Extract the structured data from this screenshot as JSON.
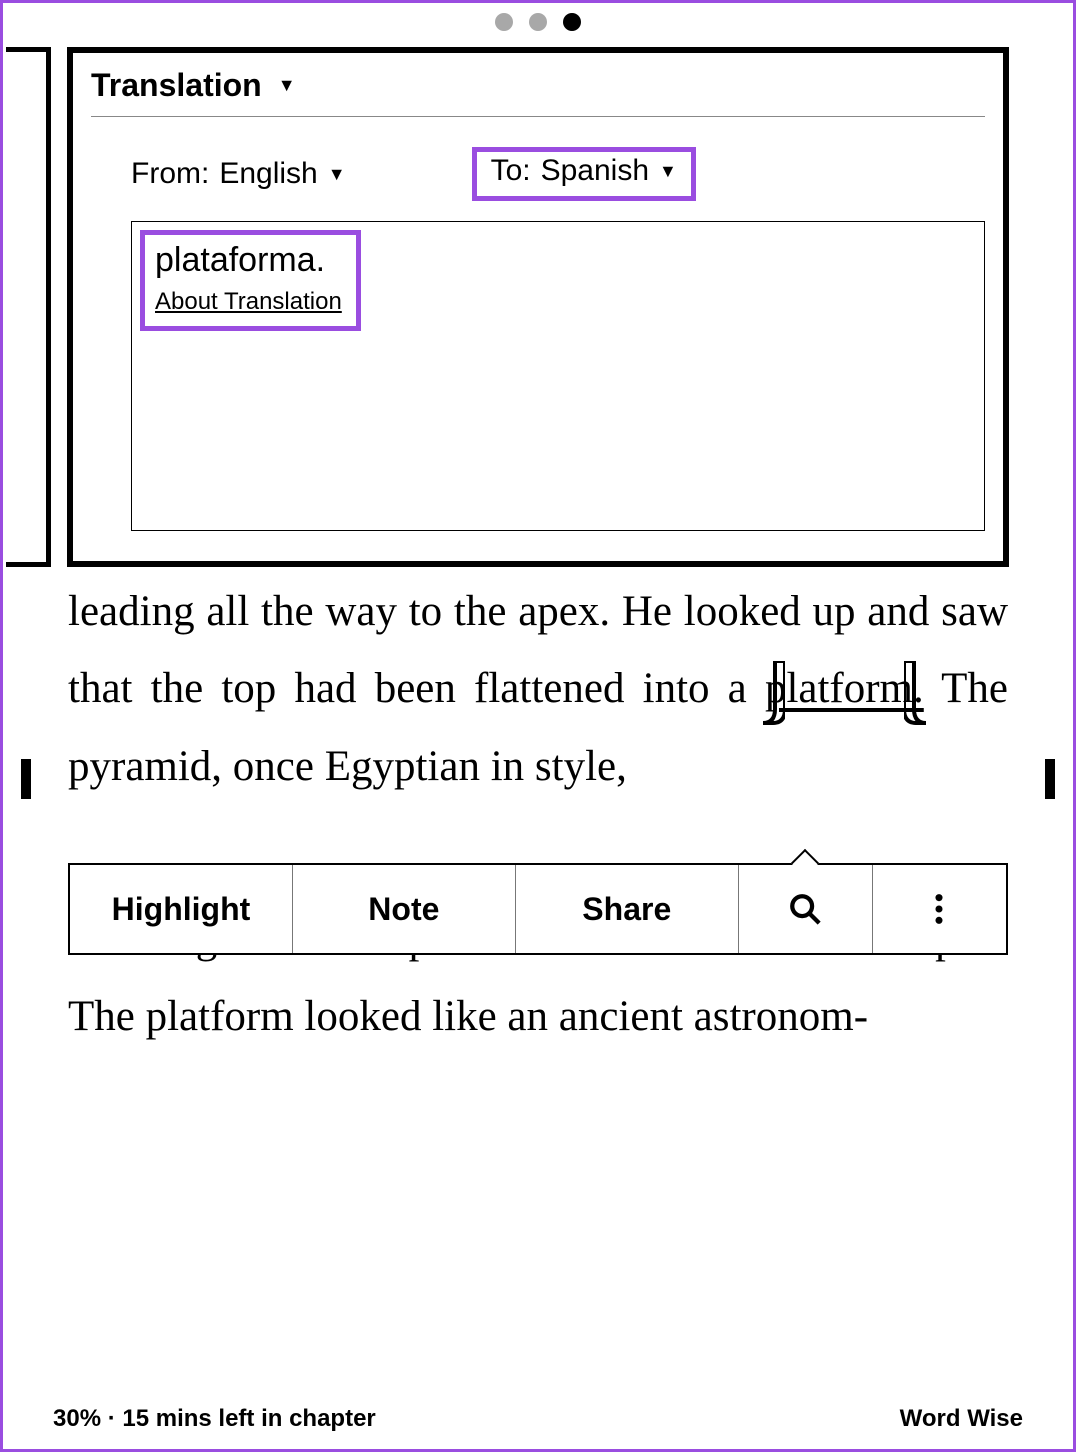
{
  "pagination_dots": {
    "total": 3,
    "active_index": 2
  },
  "translation_card": {
    "header": "Translation",
    "from_label": "From:",
    "from_lang": "English",
    "to_label": "To:",
    "to_lang": "Spanish",
    "result": "plataforma.",
    "about_link": "About Translation"
  },
  "book": {
    "paragraph1_visible": "leading all the way to the apex. He looked up and saw that the top had been flattened into a ",
    "selected_word": "platform.",
    "paragraph1_after": " The pyramid, once Egyptian in style,",
    "paragraph2_visible": "Wang climbed up the stairs and reached the apex. The platform looked like an ancient astronom-"
  },
  "toolbar": {
    "highlight": "Highlight",
    "note": "Note",
    "share": "Share"
  },
  "footer": {
    "progress": "30% · 15 mins left in chapter",
    "wordwise": "Word Wise"
  }
}
